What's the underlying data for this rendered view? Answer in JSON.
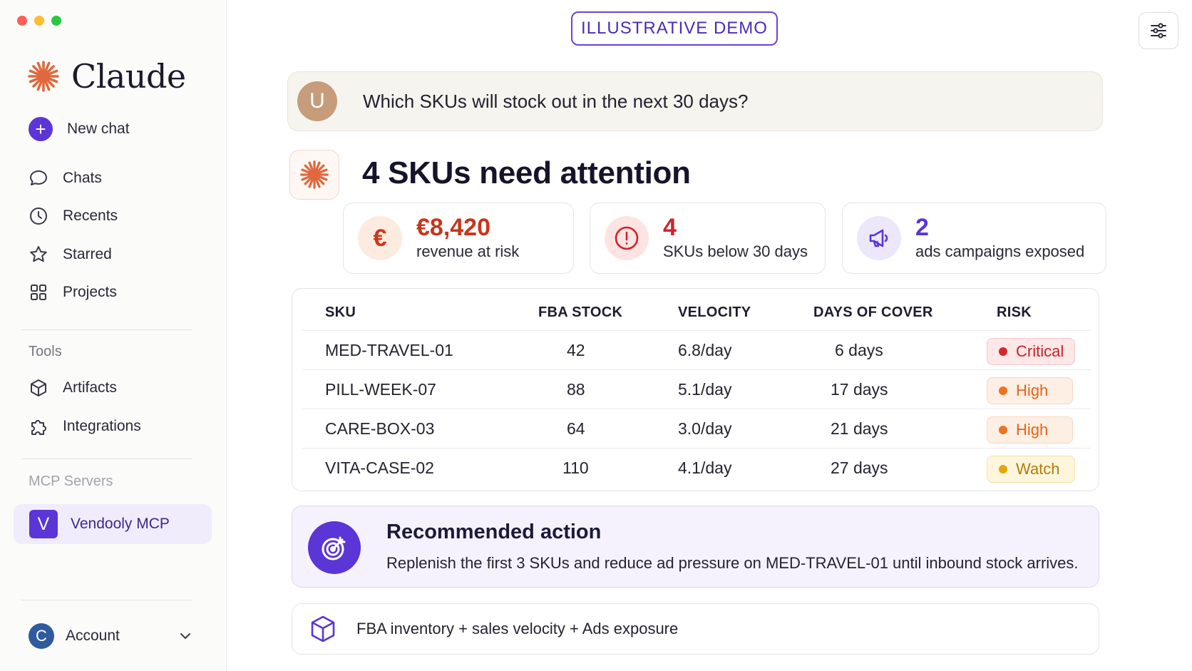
{
  "app": {
    "brand": "Claude"
  },
  "colors": {
    "accent": "#5b35d5",
    "claude_orange": "#e0683f",
    "critical": "#d7262f",
    "high": "#e8741f",
    "watch": "#e3a60f"
  },
  "sidebar": {
    "new_chat": "New chat",
    "items": [
      {
        "label": "Chats",
        "icon": "chat-bubble-icon"
      },
      {
        "label": "Recents",
        "icon": "clock-icon"
      },
      {
        "label": "Starred",
        "icon": "star-icon"
      },
      {
        "label": "Projects",
        "icon": "grid-icon"
      }
    ],
    "tools_label": "Tools",
    "tools": [
      {
        "label": "Artifacts",
        "icon": "cube-icon"
      },
      {
        "label": "Integrations",
        "icon": "puzzle-icon"
      }
    ],
    "mcp_label": "MCP Servers",
    "mcp": {
      "badge": "V",
      "label": "Vendooly MCP"
    },
    "account": {
      "initial": "C",
      "label": "Account"
    }
  },
  "main": {
    "demo_badge": "ILLUSTRATIVE DEMO",
    "user": {
      "initial": "U",
      "message": "Which SKUs will stock out in the next 30 days?"
    },
    "headline": "4 SKUs need attention",
    "stats": [
      {
        "value": "€8,420",
        "label": "revenue at risk",
        "icon": "euro-icon",
        "glyph": "€"
      },
      {
        "value": "4",
        "label": "SKUs below 30 days",
        "icon": "alert-icon"
      },
      {
        "value": "2",
        "label": "ads campaigns exposed",
        "icon": "megaphone-icon"
      }
    ],
    "table": {
      "headers": [
        "SKU",
        "FBA STOCK",
        "VELOCITY",
        "DAYS OF COVER",
        "RISK"
      ],
      "rows": [
        {
          "sku": "MED-TRAVEL-01",
          "stock": "42",
          "velocity": "6.8/day",
          "cover": "6 days",
          "risk": "Critical"
        },
        {
          "sku": "PILL-WEEK-07",
          "stock": "88",
          "velocity": "5.1/day",
          "cover": "17 days",
          "risk": "High"
        },
        {
          "sku": "CARE-BOX-03",
          "stock": "64",
          "velocity": "3.0/day",
          "cover": "21 days",
          "risk": "High"
        },
        {
          "sku": "VITA-CASE-02",
          "stock": "110",
          "velocity": "4.1/day",
          "cover": "27 days",
          "risk": "Watch"
        }
      ]
    },
    "action": {
      "title": "Recommended action",
      "body": "Replenish the first 3 SKUs and reduce ad pressure on MED-TRAVEL-01 until inbound stock arrives.",
      "icon": "target-icon"
    },
    "source": {
      "text": "FBA inventory + sales velocity + Ads exposure",
      "icon": "cube-icon"
    }
  }
}
